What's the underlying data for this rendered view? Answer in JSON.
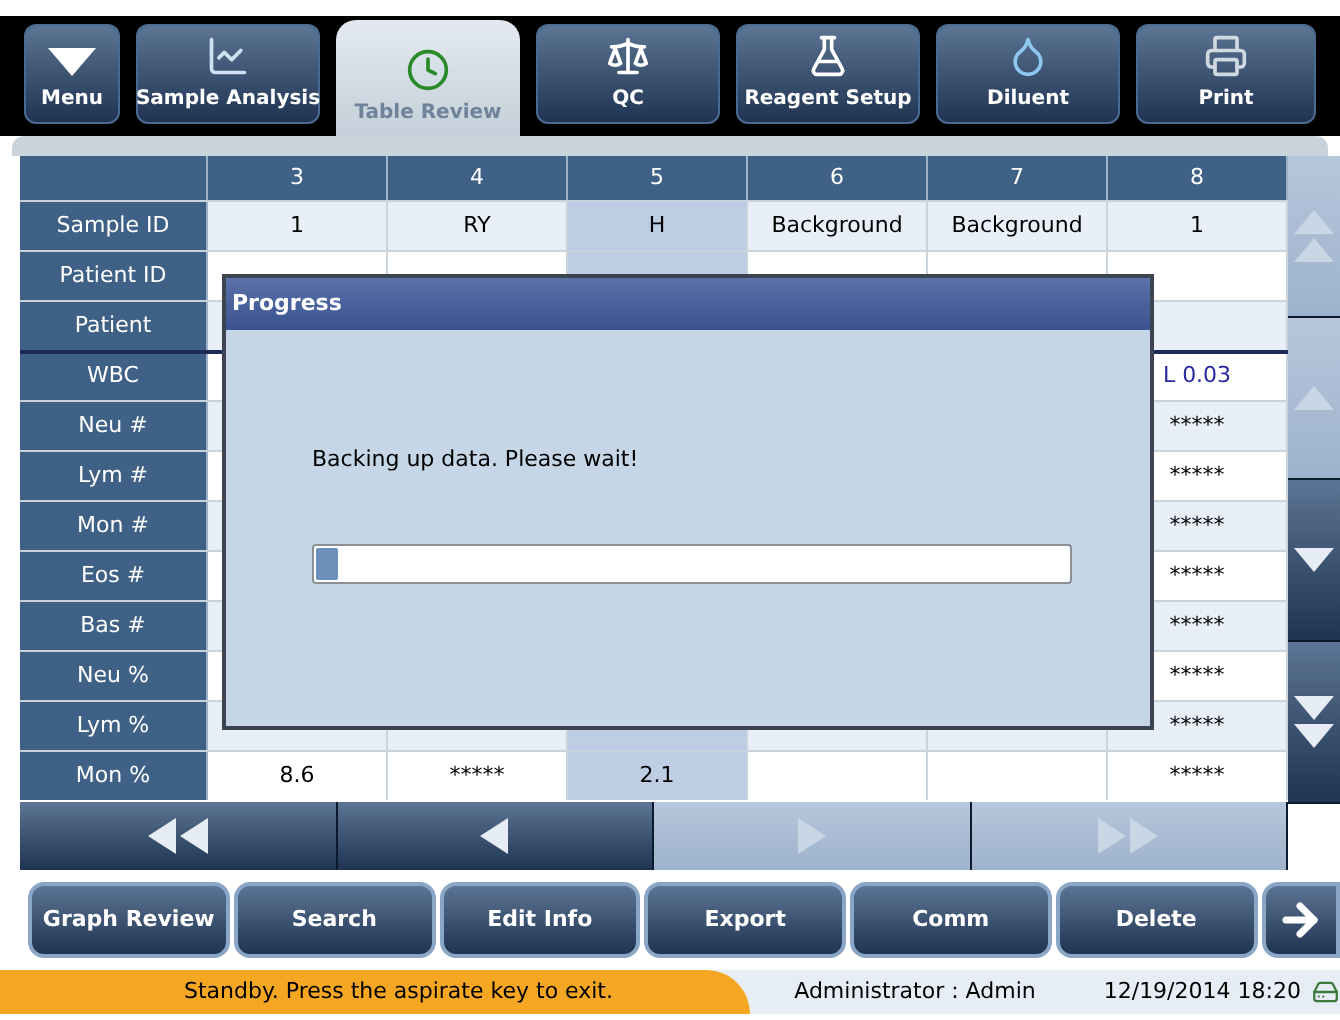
{
  "tabs": [
    {
      "label": "Menu",
      "kind": "menu",
      "selected": false
    },
    {
      "label": "Sample Analysis",
      "kind": "chart",
      "selected": false
    },
    {
      "label": "Table Review",
      "kind": "clock",
      "selected": true
    },
    {
      "label": "QC",
      "kind": "scale",
      "selected": false
    },
    {
      "label": "Reagent Setup",
      "kind": "bottles",
      "selected": false
    },
    {
      "label": "Diluent",
      "kind": "drop",
      "selected": false
    },
    {
      "label": "Print",
      "kind": "printer",
      "selected": false
    }
  ],
  "table": {
    "columns": [
      {
        "label": "3",
        "selected": false
      },
      {
        "label": "4",
        "selected": false
      },
      {
        "label": "5",
        "selected": true
      },
      {
        "label": "6",
        "selected": false
      },
      {
        "label": "7",
        "selected": false
      },
      {
        "label": "8",
        "selected": false
      }
    ],
    "rows": [
      {
        "label": "Sample ID",
        "cells": [
          "1",
          "RY",
          "H",
          "Background",
          "Background",
          "1"
        ]
      },
      {
        "label": "Patient ID",
        "cells": [
          null,
          null,
          null,
          null,
          null,
          null
        ]
      },
      {
        "label": "Patient",
        "cells": [
          null,
          null,
          null,
          null,
          null,
          null
        ]
      },
      {
        "label": "WBC",
        "cells": [
          null,
          null,
          null,
          null,
          null,
          "L 0.03"
        ]
      },
      {
        "label": "Neu #",
        "cells": [
          null,
          null,
          null,
          null,
          null,
          "*****"
        ]
      },
      {
        "label": "Lym #",
        "cells": [
          null,
          null,
          null,
          null,
          null,
          "*****"
        ]
      },
      {
        "label": "Mon #",
        "cells": [
          null,
          null,
          null,
          null,
          null,
          "*****"
        ]
      },
      {
        "label": "Eos #",
        "cells": [
          null,
          null,
          null,
          null,
          null,
          "*****"
        ]
      },
      {
        "label": "Bas #",
        "cells": [
          null,
          null,
          null,
          null,
          null,
          "*****"
        ]
      },
      {
        "label": "Neu %",
        "cells": [
          null,
          null,
          null,
          null,
          null,
          "*****"
        ]
      },
      {
        "label": "Lym %",
        "cells": [
          null,
          null,
          null,
          null,
          null,
          "*****"
        ]
      },
      {
        "label": "Mon %",
        "cells": [
          "8.6",
          "*****",
          "2.1",
          null,
          null,
          "*****"
        ]
      }
    ]
  },
  "scroll_buttons": [
    {
      "kind": "top",
      "disabled": true
    },
    {
      "kind": "up",
      "disabled": true
    },
    {
      "kind": "down",
      "disabled": false
    },
    {
      "kind": "bottom",
      "disabled": false
    }
  ],
  "page_buttons": [
    {
      "kind": "first",
      "disabled": false
    },
    {
      "kind": "prev",
      "disabled": false
    },
    {
      "kind": "next",
      "disabled": true
    },
    {
      "kind": "last",
      "disabled": true
    }
  ],
  "buttons": [
    "Graph Review",
    "Search",
    "Edit Info",
    "Export",
    "Comm",
    "Delete"
  ],
  "dialog": {
    "title": "Progress",
    "message": "Backing up data. Please wait!",
    "level": 0.03
  },
  "status_bar": {
    "message": "Standby. Press the aspirate key to exit.",
    "user": "Administrator : Admin",
    "datetime": "12/19/2014 18:20"
  }
}
